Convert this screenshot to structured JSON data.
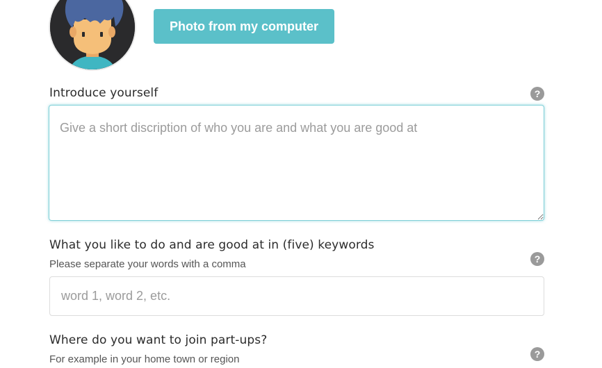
{
  "upload": {
    "button_label": "Photo from my computer"
  },
  "avatar": {
    "icon": "person-avatar-icon"
  },
  "introduce": {
    "label": "Introduce yourself",
    "placeholder": "Give a short discription of who you are and what you are good at",
    "value": "",
    "help_icon": "?"
  },
  "keywords": {
    "label": "What you like to do and are good at in (five) keywords",
    "sublabel": "Please separate your words with a comma",
    "placeholder": "word 1, word 2, etc.",
    "value": "",
    "help_icon": "?"
  },
  "location": {
    "label": "Where do you want to join part-ups?",
    "sublabel": "For example in your home town or region",
    "help_icon": "?"
  },
  "colors": {
    "accent": "#5bc0c9",
    "help_icon_bg": "#9a9a9a"
  }
}
